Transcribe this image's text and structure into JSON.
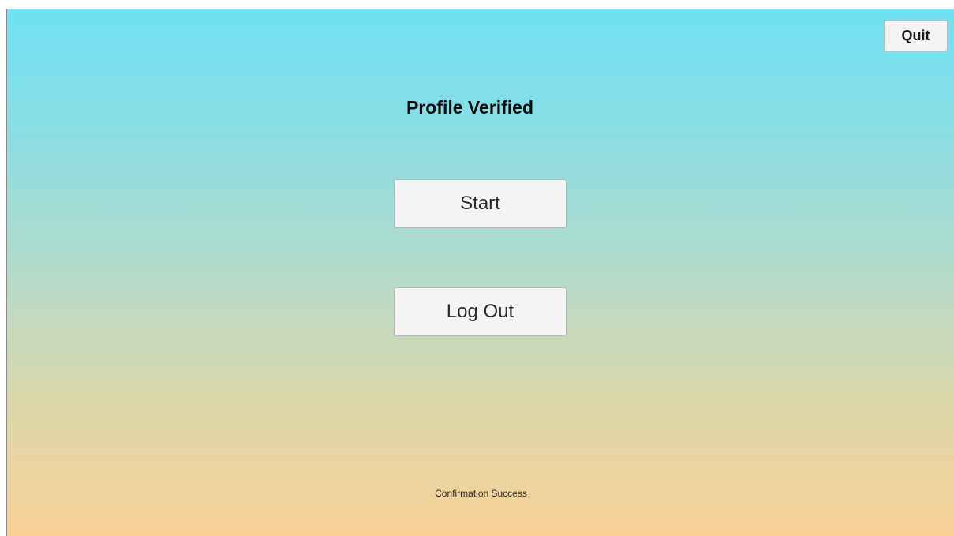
{
  "header": {
    "quit_label": "Quit"
  },
  "main": {
    "title": "Profile Verified",
    "start_label": "Start",
    "logout_label": "Log Out"
  },
  "footer": {
    "status": "Confirmation Success"
  },
  "colors": {
    "gradient_top": "#6fe1f3",
    "gradient_bottom": "#f9d196",
    "button_bg": "#f4f4f4"
  }
}
